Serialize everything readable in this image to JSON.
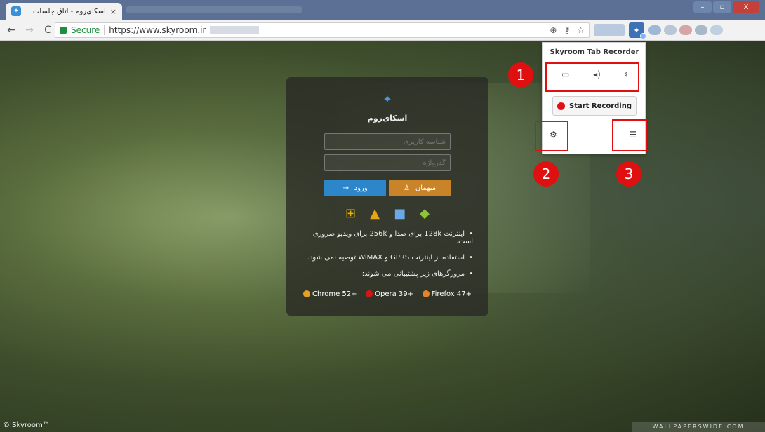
{
  "window": {
    "tab_title": "اسکای‌روم - اتاق جلسات",
    "tab_close": "×",
    "win_controls": [
      "–",
      "▫",
      "X"
    ]
  },
  "toolbar": {
    "back": "←",
    "forward": "→",
    "reload": "C",
    "secure_label": "Secure",
    "url": "https://www.skyroom.ir",
    "icons": [
      "zoom-icon",
      "key-icon",
      "star-icon"
    ]
  },
  "page": {
    "copyright": "© Skyroom™",
    "wallpaper_mark": "WALLPAPERSWIDE.COM"
  },
  "login": {
    "brand_name": "اسکای‌روم",
    "username_placeholder": "شناسه کاربری",
    "password_placeholder": "گذرواژه",
    "login_label": "ورود",
    "guest_label": "میهمان",
    "notes": [
      "اینترنت 128k برای صدا و 256k برای ویدیو ضروری است.",
      "استفاده از اینترنت GPRS و WiMAX توصیه نمی شود.",
      "مرورگرهای زیر پشتیبانی می شوند:"
    ],
    "browsers": [
      {
        "name": "Chrome 52+",
        "color": "#e8a020"
      },
      {
        "name": "Opera 39+",
        "color": "#d01818"
      },
      {
        "name": "Firefox 47+",
        "color": "#e8822a"
      }
    ]
  },
  "popup": {
    "title": "Skyroom Tab Recorder",
    "source_icons": [
      "laptop-icon",
      "speaker-icon",
      "microphone-icon"
    ],
    "start_label": "Start Recording",
    "settings_icon": "gear-icon",
    "list_icon": "list-icon"
  },
  "annotations": [
    "1",
    "2",
    "3"
  ]
}
